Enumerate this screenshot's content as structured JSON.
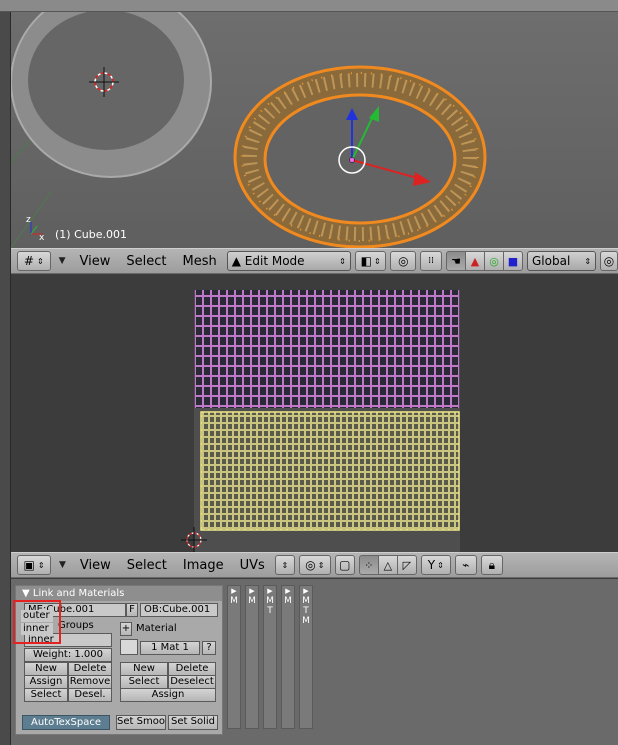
{
  "viewport3d": {
    "object_label": "(1) Cube.001"
  },
  "header3d": {
    "menus": [
      "View",
      "Select",
      "Mesh"
    ],
    "mode": "Edit Mode",
    "orientation": "Global"
  },
  "uv_header": {
    "menus": [
      "View",
      "Select",
      "Image",
      "UVs"
    ]
  },
  "panel": {
    "title": "Link and Materials",
    "mesh_field": "ME:Cube.001",
    "f_label": "F",
    "object_field": "OB:Cube.001",
    "vertex_groups_label": "Groups",
    "active_group": "inner",
    "material_label": "Material",
    "weight": "Weight: 1.000",
    "mat_index": "1 Mat 1",
    "question": "?",
    "buttons": {
      "new_vg": "New",
      "delete_vg": "Delete",
      "assign_vg": "Assign",
      "remove_vg": "Remove",
      "select_vg": "Select",
      "deselect_vg": "Desel.",
      "new_mat": "New",
      "delete_mat": "Delete",
      "select_mat": "Select",
      "deselect_mat": "Deselect",
      "assign_mat": "Assign",
      "autotex": "AutoTexSpace",
      "set_smooth": "Set Smoo",
      "set_solid": "Set Solid"
    }
  },
  "vg_popup": {
    "options": [
      "outer",
      "inner"
    ]
  },
  "mini_panels": [
    {
      "label": "M"
    },
    {
      "label": "M"
    },
    {
      "label": "MT"
    },
    {
      "label": "M"
    },
    {
      "label": "MTM"
    }
  ]
}
